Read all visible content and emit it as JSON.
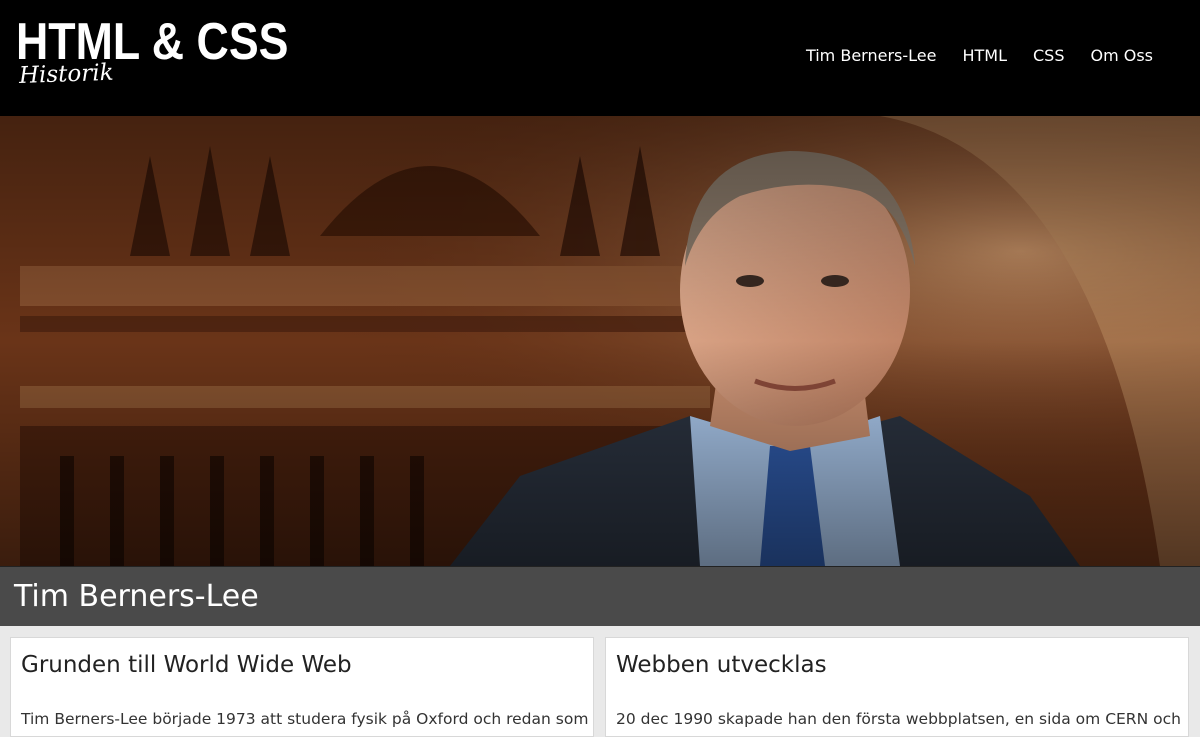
{
  "header": {
    "logo_title": "HTML & CSS",
    "logo_subtitle": "Historik",
    "nav": [
      {
        "label": "Tim Berners-Lee"
      },
      {
        "label": "HTML"
      },
      {
        "label": "CSS"
      },
      {
        "label": "Om Oss"
      }
    ]
  },
  "hero": {
    "image_icon": "portrait-photo"
  },
  "section": {
    "title": "Tim Berners-Lee"
  },
  "cards": [
    {
      "title": "Grunden till World Wide Web",
      "text": "Tim Berners-Lee började 1973 att studera fysik på Oxford och redan som"
    },
    {
      "title": "Webben utvecklas",
      "text": "20 dec 1990 skapade han den första webbplatsen, en sida om CERN och"
    }
  ],
  "colors": {
    "header_bg": "#000000",
    "title_bar_bg": "#4a4a4a",
    "page_bg": "#e9e9e9"
  }
}
